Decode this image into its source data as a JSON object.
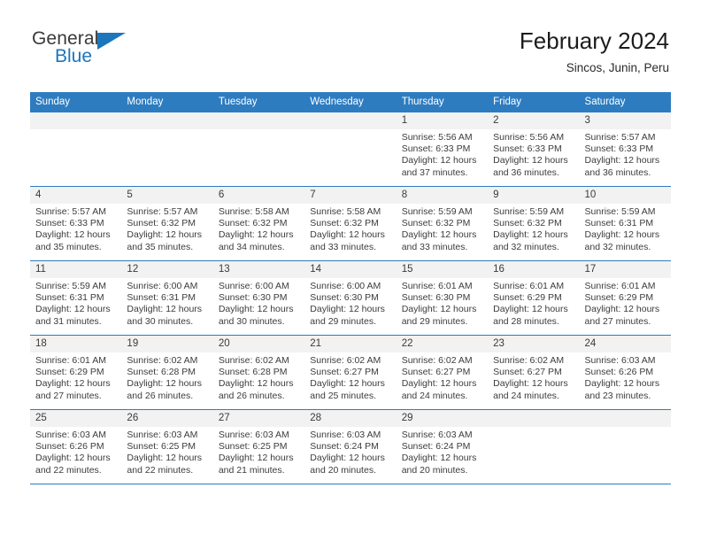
{
  "logo": {
    "word_one": "General",
    "word_two": "Blue",
    "flag_icon": "triangle-flag-icon",
    "brand_color": "#1b76bc"
  },
  "header": {
    "title": "February 2024",
    "location": "Sincos, Junin, Peru"
  },
  "theme": {
    "header_blue": "#2e7cc0",
    "daynum_band": "#f2f2f2",
    "text": "#3c3c3c"
  },
  "weekdays": [
    "Sunday",
    "Monday",
    "Tuesday",
    "Wednesday",
    "Thursday",
    "Friday",
    "Saturday"
  ],
  "labels": {
    "sunrise_prefix": "Sunrise:",
    "sunset_prefix": "Sunset:",
    "daylight_prefix": "Daylight:"
  },
  "weeks": [
    [
      {
        "day": "",
        "sunrise": "",
        "sunset": "",
        "daylight": "",
        "empty": true
      },
      {
        "day": "",
        "sunrise": "",
        "sunset": "",
        "daylight": "",
        "empty": true
      },
      {
        "day": "",
        "sunrise": "",
        "sunset": "",
        "daylight": "",
        "empty": true
      },
      {
        "day": "",
        "sunrise": "",
        "sunset": "",
        "daylight": "",
        "empty": true
      },
      {
        "day": "1",
        "sunrise": "Sunrise: 5:56 AM",
        "sunset": "Sunset: 6:33 PM",
        "daylight": "Daylight: 12 hours and 37 minutes."
      },
      {
        "day": "2",
        "sunrise": "Sunrise: 5:56 AM",
        "sunset": "Sunset: 6:33 PM",
        "daylight": "Daylight: 12 hours and 36 minutes."
      },
      {
        "day": "3",
        "sunrise": "Sunrise: 5:57 AM",
        "sunset": "Sunset: 6:33 PM",
        "daylight": "Daylight: 12 hours and 36 minutes."
      }
    ],
    [
      {
        "day": "4",
        "sunrise": "Sunrise: 5:57 AM",
        "sunset": "Sunset: 6:33 PM",
        "daylight": "Daylight: 12 hours and 35 minutes."
      },
      {
        "day": "5",
        "sunrise": "Sunrise: 5:57 AM",
        "sunset": "Sunset: 6:32 PM",
        "daylight": "Daylight: 12 hours and 35 minutes."
      },
      {
        "day": "6",
        "sunrise": "Sunrise: 5:58 AM",
        "sunset": "Sunset: 6:32 PM",
        "daylight": "Daylight: 12 hours and 34 minutes."
      },
      {
        "day": "7",
        "sunrise": "Sunrise: 5:58 AM",
        "sunset": "Sunset: 6:32 PM",
        "daylight": "Daylight: 12 hours and 33 minutes."
      },
      {
        "day": "8",
        "sunrise": "Sunrise: 5:59 AM",
        "sunset": "Sunset: 6:32 PM",
        "daylight": "Daylight: 12 hours and 33 minutes."
      },
      {
        "day": "9",
        "sunrise": "Sunrise: 5:59 AM",
        "sunset": "Sunset: 6:32 PM",
        "daylight": "Daylight: 12 hours and 32 minutes."
      },
      {
        "day": "10",
        "sunrise": "Sunrise: 5:59 AM",
        "sunset": "Sunset: 6:31 PM",
        "daylight": "Daylight: 12 hours and 32 minutes."
      }
    ],
    [
      {
        "day": "11",
        "sunrise": "Sunrise: 5:59 AM",
        "sunset": "Sunset: 6:31 PM",
        "daylight": "Daylight: 12 hours and 31 minutes."
      },
      {
        "day": "12",
        "sunrise": "Sunrise: 6:00 AM",
        "sunset": "Sunset: 6:31 PM",
        "daylight": "Daylight: 12 hours and 30 minutes."
      },
      {
        "day": "13",
        "sunrise": "Sunrise: 6:00 AM",
        "sunset": "Sunset: 6:30 PM",
        "daylight": "Daylight: 12 hours and 30 minutes."
      },
      {
        "day": "14",
        "sunrise": "Sunrise: 6:00 AM",
        "sunset": "Sunset: 6:30 PM",
        "daylight": "Daylight: 12 hours and 29 minutes."
      },
      {
        "day": "15",
        "sunrise": "Sunrise: 6:01 AM",
        "sunset": "Sunset: 6:30 PM",
        "daylight": "Daylight: 12 hours and 29 minutes."
      },
      {
        "day": "16",
        "sunrise": "Sunrise: 6:01 AM",
        "sunset": "Sunset: 6:29 PM",
        "daylight": "Daylight: 12 hours and 28 minutes."
      },
      {
        "day": "17",
        "sunrise": "Sunrise: 6:01 AM",
        "sunset": "Sunset: 6:29 PM",
        "daylight": "Daylight: 12 hours and 27 minutes."
      }
    ],
    [
      {
        "day": "18",
        "sunrise": "Sunrise: 6:01 AM",
        "sunset": "Sunset: 6:29 PM",
        "daylight": "Daylight: 12 hours and 27 minutes."
      },
      {
        "day": "19",
        "sunrise": "Sunrise: 6:02 AM",
        "sunset": "Sunset: 6:28 PM",
        "daylight": "Daylight: 12 hours and 26 minutes."
      },
      {
        "day": "20",
        "sunrise": "Sunrise: 6:02 AM",
        "sunset": "Sunset: 6:28 PM",
        "daylight": "Daylight: 12 hours and 26 minutes."
      },
      {
        "day": "21",
        "sunrise": "Sunrise: 6:02 AM",
        "sunset": "Sunset: 6:27 PM",
        "daylight": "Daylight: 12 hours and 25 minutes."
      },
      {
        "day": "22",
        "sunrise": "Sunrise: 6:02 AM",
        "sunset": "Sunset: 6:27 PM",
        "daylight": "Daylight: 12 hours and 24 minutes."
      },
      {
        "day": "23",
        "sunrise": "Sunrise: 6:02 AM",
        "sunset": "Sunset: 6:27 PM",
        "daylight": "Daylight: 12 hours and 24 minutes."
      },
      {
        "day": "24",
        "sunrise": "Sunrise: 6:03 AM",
        "sunset": "Sunset: 6:26 PM",
        "daylight": "Daylight: 12 hours and 23 minutes."
      }
    ],
    [
      {
        "day": "25",
        "sunrise": "Sunrise: 6:03 AM",
        "sunset": "Sunset: 6:26 PM",
        "daylight": "Daylight: 12 hours and 22 minutes."
      },
      {
        "day": "26",
        "sunrise": "Sunrise: 6:03 AM",
        "sunset": "Sunset: 6:25 PM",
        "daylight": "Daylight: 12 hours and 22 minutes."
      },
      {
        "day": "27",
        "sunrise": "Sunrise: 6:03 AM",
        "sunset": "Sunset: 6:25 PM",
        "daylight": "Daylight: 12 hours and 21 minutes."
      },
      {
        "day": "28",
        "sunrise": "Sunrise: 6:03 AM",
        "sunset": "Sunset: 6:24 PM",
        "daylight": "Daylight: 12 hours and 20 minutes."
      },
      {
        "day": "29",
        "sunrise": "Sunrise: 6:03 AM",
        "sunset": "Sunset: 6:24 PM",
        "daylight": "Daylight: 12 hours and 20 minutes."
      },
      {
        "day": "",
        "sunrise": "",
        "sunset": "",
        "daylight": "",
        "empty": true
      },
      {
        "day": "",
        "sunrise": "",
        "sunset": "",
        "daylight": "",
        "empty": true
      }
    ]
  ]
}
